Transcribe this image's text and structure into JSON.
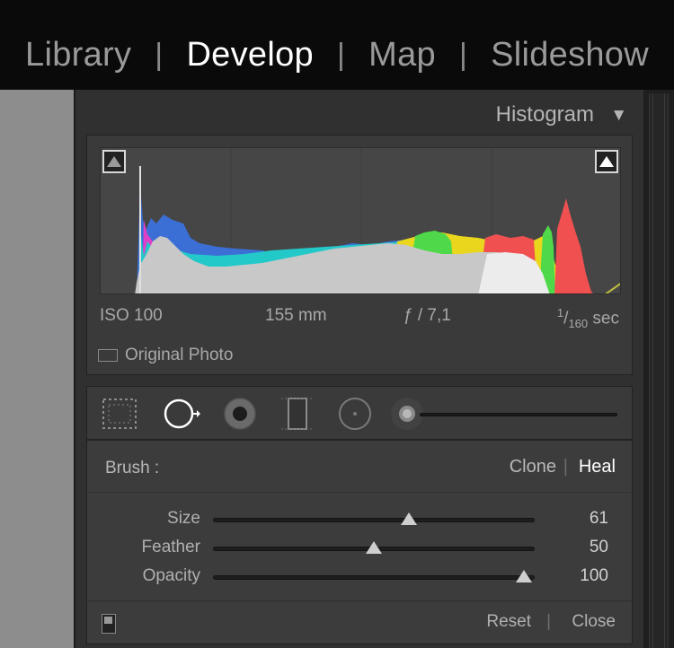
{
  "modules": {
    "items": [
      "Library",
      "Develop",
      "Map",
      "Slideshow"
    ],
    "active": "Develop"
  },
  "histogram": {
    "title": "Histogram",
    "collapse_icon": "triangle-down-icon",
    "iso": "ISO 100",
    "focal_length": "155 mm",
    "aperture": "ƒ / 7,1",
    "shutter_num": "1",
    "shutter_den": "160",
    "shutter_unit": "sec",
    "original_photo_label": "Original Photo"
  },
  "tools": {
    "icons": [
      "crop-overlay-icon",
      "spot-removal-icon",
      "red-eye-icon",
      "graduated-filter-icon",
      "radial-filter-icon",
      "adjustment-brush-icon"
    ]
  },
  "brush": {
    "label": "Brush :",
    "mode_clone": "Clone",
    "mode_heal": "Heal",
    "active_mode": "Heal",
    "sliders": [
      {
        "label": "Size",
        "value": "61",
        "position": 0.61
      },
      {
        "label": "Feather",
        "value": "50",
        "position": 0.5
      },
      {
        "label": "Opacity",
        "value": "100",
        "position": 1.0
      }
    ],
    "reset_label": "Reset",
    "close_label": "Close"
  }
}
